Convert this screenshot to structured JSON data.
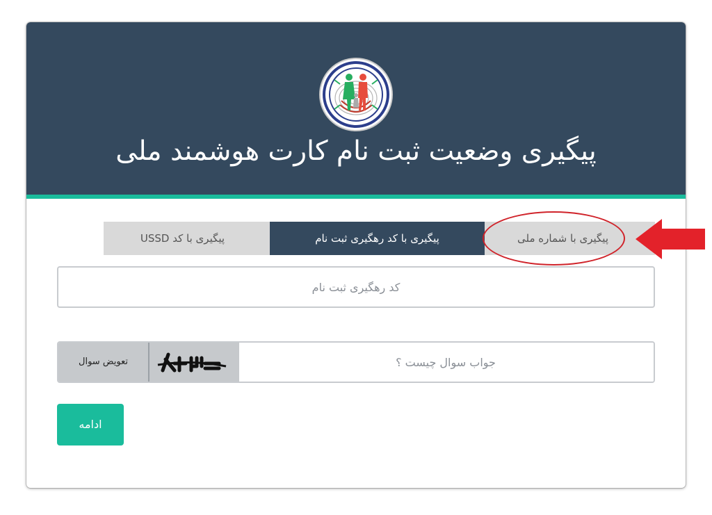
{
  "header": {
    "title": "پیگیری وضعیت ثبت نام کارت هوشمند ملی",
    "logo_icon": "family-fingerprint-logo"
  },
  "tabs": [
    {
      "label": "پیگیری با شماره ملی"
    },
    {
      "label": "پیگیری با کد رهگیری ثبت نام",
      "active": true
    },
    {
      "label": "پیگیری با کد USSD"
    }
  ],
  "tracking_field": {
    "placeholder": "کد رهگیری ثبت نام",
    "value": ""
  },
  "captcha": {
    "placeholder": "جواب سوال چیست ؟",
    "swap_label": "تعویض سوال",
    "image_text": "۸+۳="
  },
  "continue_button": {
    "label": "ادامه"
  },
  "colors": {
    "header": "#34495e",
    "accent": "#1abc9c",
    "tab_inactive": "#d9d9d9",
    "annotation": "#e3222a"
  },
  "annotation": {
    "arrow_icon": "red-arrow-icon",
    "highlight": "red-ellipse"
  }
}
